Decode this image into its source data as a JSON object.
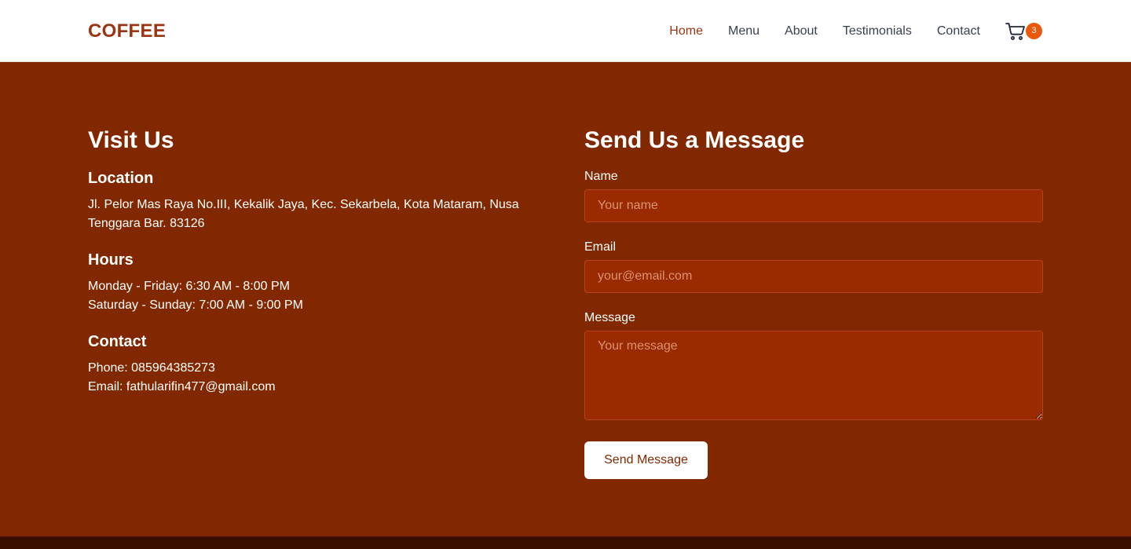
{
  "nav": {
    "brand": "COFFEE",
    "links": [
      {
        "label": "Home",
        "active": true
      },
      {
        "label": "Menu"
      },
      {
        "label": "About"
      },
      {
        "label": "Testimonials"
      },
      {
        "label": "Contact"
      }
    ],
    "cart_count": "3"
  },
  "visit": {
    "title": "Visit Us",
    "location_heading": "Location",
    "location_line1": "Jl. Pelor Mas Raya No.III, Kekalik Jaya, Kec. Sekarbela, Kota Mataram, Nusa",
    "location_line2": "Tenggara Bar. 83126",
    "hours_heading": "Hours",
    "hours_weekday": "Monday - Friday: 6:30 AM - 8:00 PM",
    "hours_weekend": "Saturday - Sunday: 7:00 AM - 9:00 PM",
    "contact_heading": "Contact",
    "phone": "Phone: 085964385273",
    "email": "Email: fathularifin477@gmail.com"
  },
  "form": {
    "title": "Send Us a Message",
    "name_label": "Name",
    "name_placeholder": "Your name",
    "email_label": "Email",
    "email_placeholder": "your@email.com",
    "message_label": "Message",
    "message_placeholder": "Your message",
    "submit_label": "Send Message"
  },
  "colors": {
    "brand": "#9a3412",
    "section_bg": "#822800",
    "input_bg": "#9a2a00",
    "badge": "#ea580c"
  },
  "icons": {
    "cart": "shopping-cart-icon"
  }
}
